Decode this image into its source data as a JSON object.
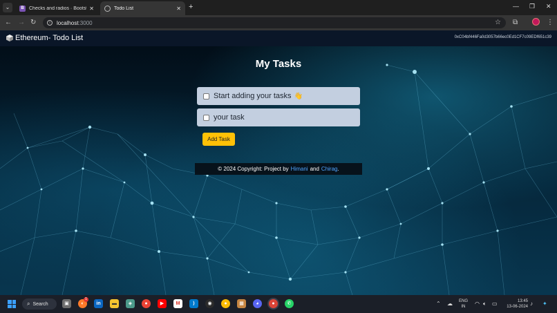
{
  "browser": {
    "tabs": [
      {
        "title": "Checks and radios · Bootstrap v",
        "active": false
      },
      {
        "title": "Todo List",
        "active": true
      }
    ],
    "address": {
      "host": "localhost",
      "port": ":3000"
    }
  },
  "app": {
    "brand": "Ethereum- Todo List",
    "account": "0xC04bf446Fa0d3057b66ec0Ed1CF7c09EDf651c39",
    "heading": "My Tasks",
    "tasks": [
      {
        "text": "Start adding your tasks",
        "emoji": "👋",
        "checked": false
      },
      {
        "text": "your task",
        "emoji": "",
        "checked": false
      }
    ],
    "add_button": "Add Task",
    "footer": {
      "prefix": "© 2024 Copyright: Project by",
      "author1": "Himani",
      "joiner": "and",
      "author2": "Chirag",
      "suffix": "."
    }
  },
  "taskbar": {
    "search_label": "Search",
    "language": {
      "line1": "ENG",
      "line2": "IN"
    },
    "time": "13:45",
    "date": "13-06-2024",
    "badge_count": "1"
  },
  "colors": {
    "navbar": "#0a1628",
    "task_bg": "#c3cfe0",
    "add_button": "#ffc107",
    "link": "#4ea3ff",
    "taskbar": "#1b1f28"
  }
}
